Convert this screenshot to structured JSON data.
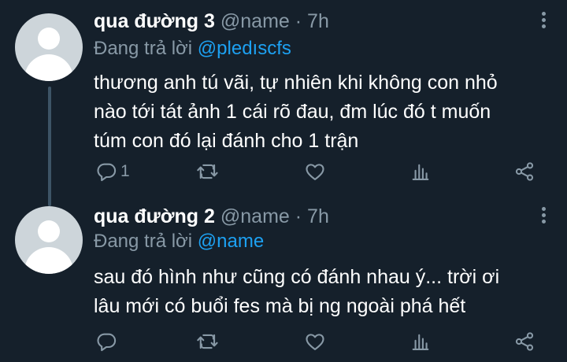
{
  "tweets": [
    {
      "author": "qua đường 3",
      "handle": "@name",
      "separator": "·",
      "time": "7h",
      "reply_prefix": "Đang trả lời ",
      "reply_to": "@pledıscfs",
      "lines": [
        "thương anh tú vãi, tự nhiên khi không con nhỏ",
        "nào tới tát ảnh 1 cái rõ đau, đm lúc đó t muốn",
        "túm con đó lại đánh cho 1 trận"
      ],
      "reply_count": "1",
      "icons": {
        "more": "more-vertical-icon",
        "reply": "reply-icon",
        "retweet": "retweet-icon",
        "like": "heart-icon",
        "stats": "analytics-icon",
        "share": "share-icon"
      }
    },
    {
      "author": "qua đường 2",
      "handle": "@name",
      "separator": "·",
      "time": "7h",
      "reply_prefix": "Đang trả lời ",
      "reply_to": "@name",
      "lines": [
        "sau đó hình như cũng có đánh nhau ý... trời ơi",
        "lâu mới có buổi fes mà bị ng ngoài phá hết"
      ],
      "reply_count": "",
      "icons": {
        "more": "more-vertical-icon",
        "reply": "reply-icon",
        "retweet": "retweet-icon",
        "like": "heart-icon",
        "stats": "analytics-icon",
        "share": "share-icon"
      }
    }
  ],
  "colors": {
    "background": "#15202b",
    "text": "#ffffff",
    "muted": "#8899a6",
    "mention": "#1da1f2",
    "avatar": "#cdd5da"
  }
}
